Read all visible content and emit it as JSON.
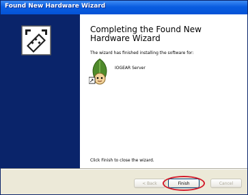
{
  "window": {
    "title": "Found New Hardware Wizard"
  },
  "sidebar": {
    "icon": "hardware-wizard-icon"
  },
  "content": {
    "heading": "Completing the Found New Hardware Wizard",
    "installed_message": "The wizard has finished installing the software for:",
    "device": {
      "icon": "device-leaf-icon",
      "name": "IOGEAR Server"
    },
    "close_message": "Click Finish to close the wizard."
  },
  "buttons": {
    "back": "< Back",
    "finish": "Finish",
    "cancel": "Cancel"
  },
  "colors": {
    "titlebar": "#0453d6",
    "sidebar": "#0a246a",
    "highlight_ring": "#d31a2a"
  }
}
